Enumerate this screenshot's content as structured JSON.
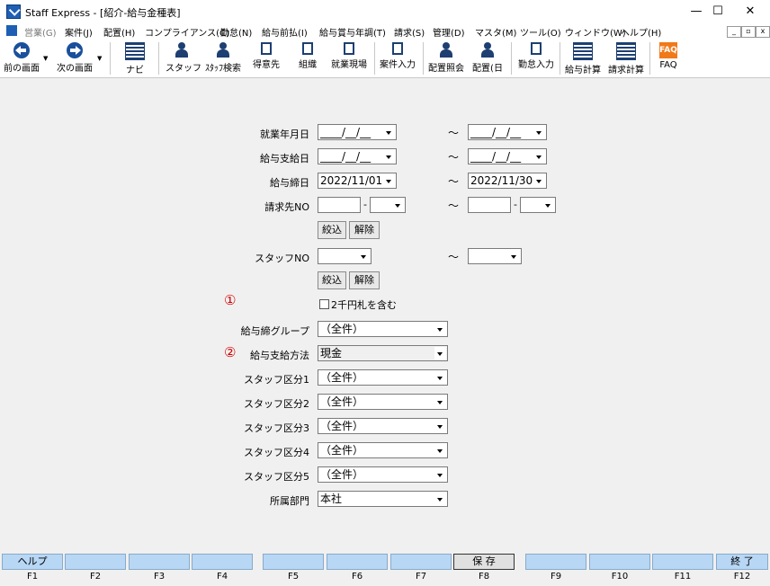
{
  "window": {
    "title": "Staff Express - [紹介-給与金種表]",
    "minimize": "—",
    "maximize": "☐",
    "close": "✕"
  },
  "menu": {
    "items": [
      "営業(G)",
      "案件(J)",
      "配置(H)",
      "コンプライアンス(C)",
      "勤怠(N)",
      "給与前払(I)",
      "給与賞与年調(T)",
      "請求(S)",
      "管理(D)",
      "マスタ(M)",
      "ツール(O)",
      "ウィンドウ(W)",
      "ヘルプ(H)"
    ],
    "mdi": [
      "_",
      "▫",
      "x"
    ]
  },
  "toolbar": {
    "prev": "前の画面",
    "next": "次の画面",
    "navi": "ナビ",
    "staff": "スタッフ",
    "staff_search": "ｽﾀｯﾌ検索",
    "client": "得意先",
    "org": "組織",
    "site": "就業現場",
    "case_input": "案件入力",
    "assign_inquiry": "配置照会",
    "assign_day": "配置(日",
    "attendance": "勤怠入力",
    "payroll": "給与計算",
    "billing": "請求計算",
    "faq": "FAQ",
    "faq_icon_text": "FAQ"
  },
  "form": {
    "tilde": "～",
    "dash": "-",
    "work_date": {
      "label": "就業年月日",
      "from": "____/__/__",
      "to": "____/__/__"
    },
    "pay_date": {
      "label": "給与支給日",
      "from": "____/__/__",
      "to": "____/__/__"
    },
    "close_date": {
      "label": "給与締日",
      "from": "2022/11/01",
      "to": "2022/11/30"
    },
    "client_no": {
      "label": "請求先NO",
      "from": "",
      "from_sub": "",
      "to": "",
      "to_sub": ""
    },
    "narrow1": "絞込",
    "clear1": "解除",
    "staff_no": {
      "label": "スタッフNO",
      "from": "",
      "to": ""
    },
    "narrow2": "絞込",
    "clear2": "解除",
    "mark1": "①",
    "include_2000": "2千円札を含む",
    "pay_group": {
      "label": "給与締グループ",
      "value": "（全件）"
    },
    "mark2": "②",
    "pay_method": {
      "label": "給与支給方法",
      "value": "現金"
    },
    "staff_cat1": {
      "label": "スタッフ区分1",
      "value": "（全件）"
    },
    "staff_cat2": {
      "label": "スタッフ区分2",
      "value": "（全件）"
    },
    "staff_cat3": {
      "label": "スタッフ区分3",
      "value": "（全件）"
    },
    "staff_cat4": {
      "label": "スタッフ区分4",
      "value": "（全件）"
    },
    "staff_cat5": {
      "label": "スタッフ区分5",
      "value": "（全件）"
    },
    "department": {
      "label": "所属部門",
      "value": "本社"
    }
  },
  "fkeys": [
    {
      "label": "ヘルプ",
      "key": "F1"
    },
    {
      "label": "",
      "key": "F2"
    },
    {
      "label": "",
      "key": "F3"
    },
    {
      "label": "",
      "key": "F4"
    },
    {
      "label": "",
      "key": "F5"
    },
    {
      "label": "",
      "key": "F6"
    },
    {
      "label": "",
      "key": "F7"
    },
    {
      "label": "保 存",
      "key": "F8"
    },
    {
      "label": "",
      "key": "F9"
    },
    {
      "label": "",
      "key": "F10"
    },
    {
      "label": "",
      "key": "F11"
    },
    {
      "label": "終 了",
      "key": "F12"
    }
  ]
}
